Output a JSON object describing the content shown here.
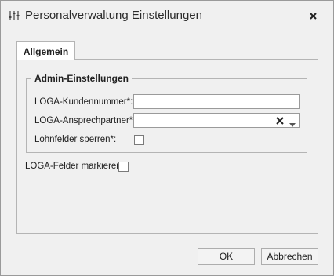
{
  "window": {
    "title": "Personalverwaltung Einstellungen"
  },
  "tabs": [
    {
      "label": "Allgemein",
      "active": true
    }
  ],
  "admin_group": {
    "title": "Admin-Einstellungen",
    "fields": {
      "kundennummer": {
        "label": "LOGA-Kundennummer*:",
        "value": ""
      },
      "ansprechpartner": {
        "label": "LOGA-Ansprechpartner*:",
        "value": ""
      },
      "lohnfelder": {
        "label": "Lohnfelder sperren*:",
        "checked": false
      }
    }
  },
  "loga_felder": {
    "label": "LOGA-Felder markieren:",
    "checked": false
  },
  "buttons": {
    "ok": "OK",
    "cancel": "Abbrechen"
  },
  "icons": {
    "title": "sliders-icon",
    "close": "close-icon",
    "clear": "clear-icon",
    "dropdown": "chevron-down-icon"
  }
}
